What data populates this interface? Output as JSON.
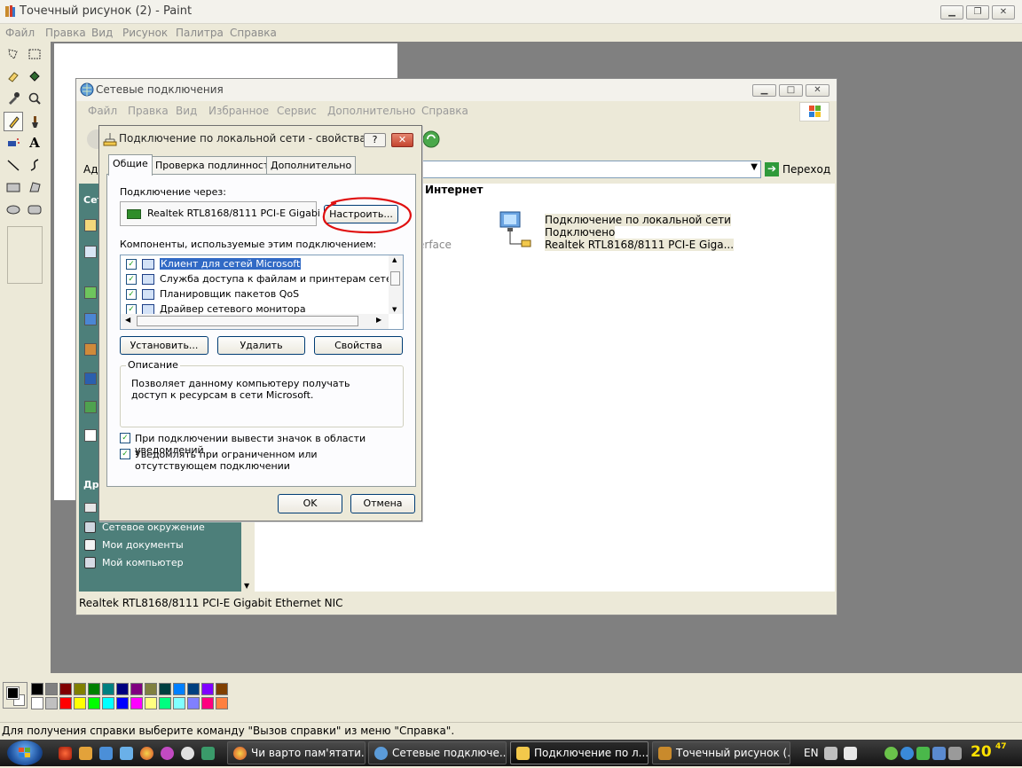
{
  "paint": {
    "title": "Точечный рисунок (2) - Paint",
    "menu": [
      "Файл",
      "Правка",
      "Вид",
      "Рисунок",
      "Палитра",
      "Справка"
    ],
    "status": "Для получения справки выберите команду \"Вызов справки\" из меню \"Справка\".",
    "palette_top": [
      "#000000",
      "#808080",
      "#800000",
      "#808000",
      "#008000",
      "#008080",
      "#000080",
      "#800080",
      "#808040",
      "#004040",
      "#0080ff",
      "#004080",
      "#8000ff",
      "#804000"
    ],
    "palette_bottom": [
      "#ffffff",
      "#c0c0c0",
      "#ff0000",
      "#ffff00",
      "#00ff00",
      "#00ffff",
      "#0000ff",
      "#ff00ff",
      "#ffff80",
      "#00ff80",
      "#80ffff",
      "#8080ff",
      "#ff0080",
      "#ff8040"
    ],
    "fg_color": "#000000",
    "bg_color": "#ffffff"
  },
  "net_window": {
    "title": "Сетевые подключения",
    "menu": [
      "Файл",
      "Правка",
      "Вид",
      "Избранное",
      "Сервис",
      "Дополнительно",
      "Справка"
    ],
    "address_label": "Адр",
    "go_label": "Переход",
    "sidebar_section_1": "Сет",
    "sidebar_section_2": "Дру",
    "sidebar_links": [
      "Сетевое окружение",
      "Мои документы",
      "Мой компьютер"
    ],
    "group_heading": "Интернет",
    "partial_text": "erface",
    "connection": {
      "name": "Подключение по локальной сети",
      "state": "Подключено",
      "device": "Realtek RTL8168/8111 PCI-E Giga..."
    },
    "status": "Realtek RTL8168/8111 PCI-E Gigabit Ethernet NIC"
  },
  "dialog": {
    "title": "Подключение по локальной сети - свойства",
    "help": "?",
    "close": "✕",
    "tabs": [
      "Общие",
      "Проверка подлинности",
      "Дополнительно"
    ],
    "connect_using_label": "Подключение через:",
    "adapter_name": "Realtek RTL8168/8111 PCI-E Gigabi",
    "configure_button": "Настроить...",
    "components_label": "Компоненты, используемые этим подключением:",
    "components": [
      {
        "name": "Клиент для сетей Microsoft",
        "checked": true,
        "selected": true
      },
      {
        "name": "Служба доступа к файлам и принтерам сетей Micro",
        "checked": true,
        "selected": false
      },
      {
        "name": "Планировщик пакетов QoS",
        "checked": true,
        "selected": false
      },
      {
        "name": "Драйвер сетевого монитора",
        "checked": true,
        "selected": false
      }
    ],
    "install_button": "Установить...",
    "uninstall_button": "Удалить",
    "properties_button": "Свойства",
    "description_legend": "Описание",
    "description_text": "Позволяет данному компьютеру получать доступ к ресурсам в сети Microsoft.",
    "show_icon_checkbox": "При подключении вывести значок в области уведомлений",
    "notify_checkbox": "Уведомлять при ограниченном или отсутствующем подключении",
    "ok_button": "OK",
    "cancel_button": "Отмена",
    "checkmark": "✓"
  },
  "taskbar": {
    "tasks": [
      {
        "label": "Чи варто пам'ятати..."
      },
      {
        "label": "Сетевые подключе..."
      },
      {
        "label": "Подключение по л..."
      },
      {
        "label": "Точечный рисунок (..."
      }
    ],
    "language": "EN",
    "clock": "20",
    "clock_small": "47"
  }
}
